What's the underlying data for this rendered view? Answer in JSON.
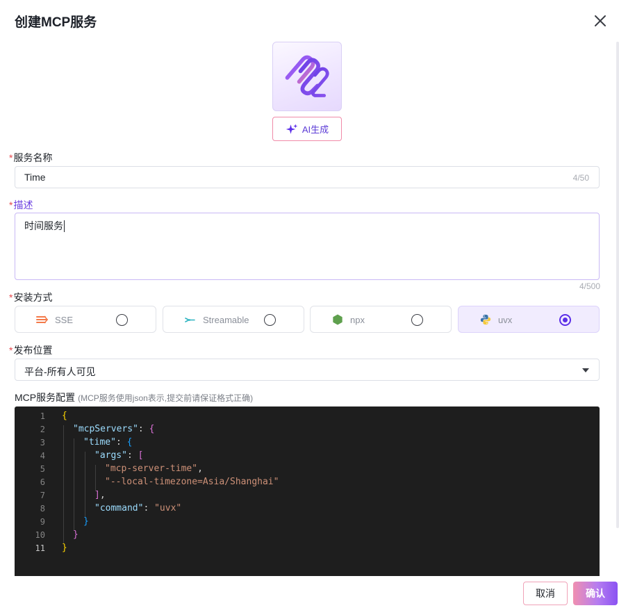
{
  "dialog": {
    "title": "创建MCP服务",
    "close_icon": "close-icon"
  },
  "logo": {
    "icon": "mcp-logo-icon",
    "ai_button_label": "AI生成",
    "ai_icon": "sparkle-icon"
  },
  "colors": {
    "accent": "#5b2ee8",
    "required": "#e5484d",
    "editor_bg": "#1e1e1e"
  },
  "form": {
    "name": {
      "required_mark": "*",
      "label": "服务名称",
      "value": "Time",
      "count": "4/50"
    },
    "description": {
      "required_mark": "*",
      "label": "描述",
      "value": "时间服务",
      "count": "4/500"
    },
    "install": {
      "required_mark": "*",
      "label": "安装方式",
      "options": [
        {
          "label": "SSE",
          "icon": "sse-icon",
          "selected": false
        },
        {
          "label": "Streamable",
          "icon": "streamable-icon",
          "selected": false
        },
        {
          "label": "npx",
          "icon": "node-hexagon-icon",
          "selected": false
        },
        {
          "label": "uvx",
          "icon": "python-icon",
          "selected": true
        }
      ]
    },
    "publish": {
      "required_mark": "*",
      "label": "发布位置",
      "value": "平台-所有人可见"
    },
    "config": {
      "label": "MCP服务配置",
      "hint": "(MCP服务使用json表示,提交前请保证格式正确)",
      "line_numbers": [
        "1",
        "2",
        "3",
        "4",
        "5",
        "6",
        "7",
        "8",
        "9",
        "10",
        "11"
      ],
      "active_line": "11",
      "tokens": {
        "l1": [
          "{"
        ],
        "l2": [
          "\"mcpServers\"",
          ": ",
          "{"
        ],
        "l3": [
          "\"time\"",
          ": ",
          "{"
        ],
        "l4": [
          "\"args\"",
          ": ",
          "["
        ],
        "l5": [
          "\"mcp-server-time\"",
          ","
        ],
        "l6": [
          "\"--local-timezone=Asia/Shanghai\""
        ],
        "l7": [
          "]",
          ","
        ],
        "l8": [
          "\"command\"",
          ": ",
          "\"uvx\""
        ],
        "l9": [
          "}"
        ],
        "l10": [
          "}"
        ],
        "l11": [
          "}"
        ]
      }
    }
  },
  "footer": {
    "cancel_label": "取消",
    "confirm_label": "确认"
  }
}
